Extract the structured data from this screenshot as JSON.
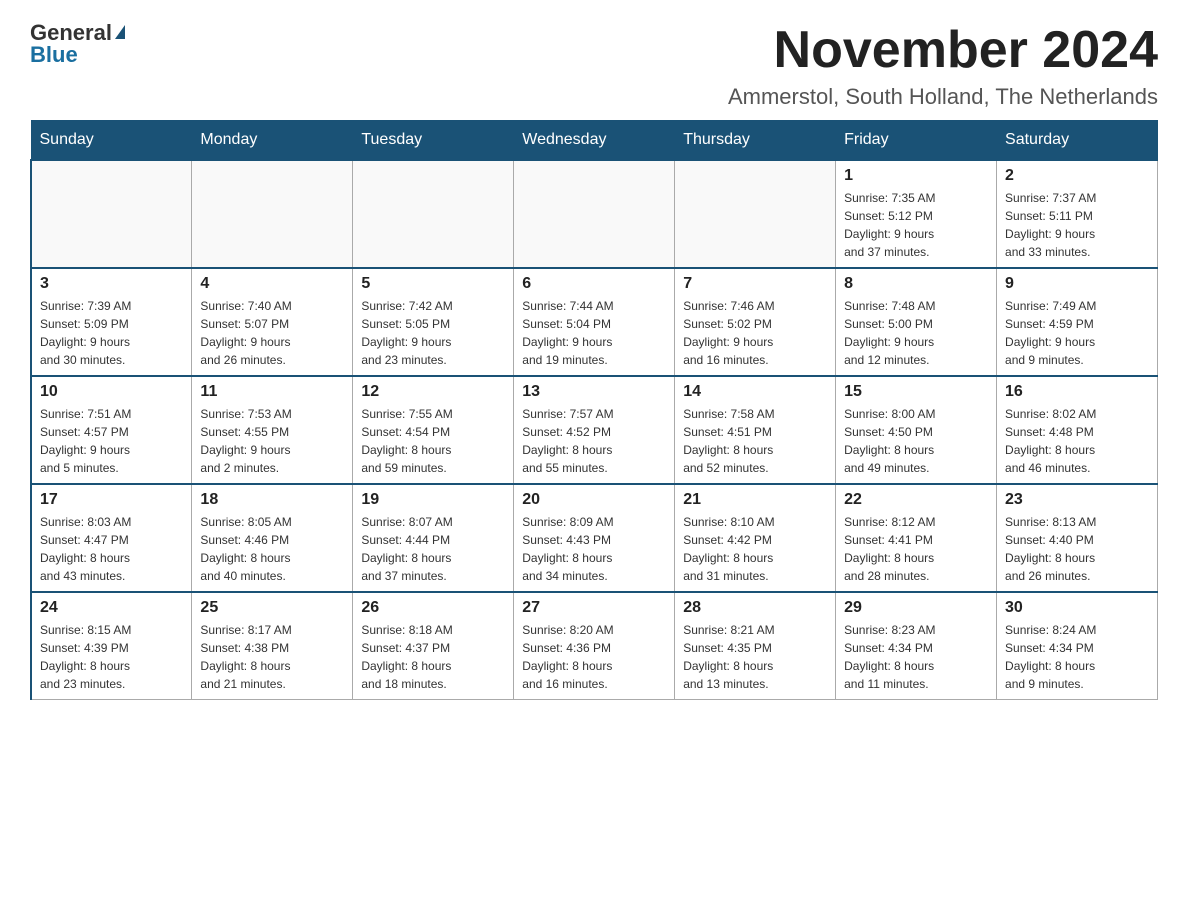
{
  "logo": {
    "general": "General",
    "blue": "Blue"
  },
  "header": {
    "month_title": "November 2024",
    "location": "Ammerstol, South Holland, The Netherlands"
  },
  "weekdays": [
    "Sunday",
    "Monday",
    "Tuesday",
    "Wednesday",
    "Thursday",
    "Friday",
    "Saturday"
  ],
  "weeks": [
    [
      {
        "day": "",
        "info": ""
      },
      {
        "day": "",
        "info": ""
      },
      {
        "day": "",
        "info": ""
      },
      {
        "day": "",
        "info": ""
      },
      {
        "day": "",
        "info": ""
      },
      {
        "day": "1",
        "info": "Sunrise: 7:35 AM\nSunset: 5:12 PM\nDaylight: 9 hours\nand 37 minutes."
      },
      {
        "day": "2",
        "info": "Sunrise: 7:37 AM\nSunset: 5:11 PM\nDaylight: 9 hours\nand 33 minutes."
      }
    ],
    [
      {
        "day": "3",
        "info": "Sunrise: 7:39 AM\nSunset: 5:09 PM\nDaylight: 9 hours\nand 30 minutes."
      },
      {
        "day": "4",
        "info": "Sunrise: 7:40 AM\nSunset: 5:07 PM\nDaylight: 9 hours\nand 26 minutes."
      },
      {
        "day": "5",
        "info": "Sunrise: 7:42 AM\nSunset: 5:05 PM\nDaylight: 9 hours\nand 23 minutes."
      },
      {
        "day": "6",
        "info": "Sunrise: 7:44 AM\nSunset: 5:04 PM\nDaylight: 9 hours\nand 19 minutes."
      },
      {
        "day": "7",
        "info": "Sunrise: 7:46 AM\nSunset: 5:02 PM\nDaylight: 9 hours\nand 16 minutes."
      },
      {
        "day": "8",
        "info": "Sunrise: 7:48 AM\nSunset: 5:00 PM\nDaylight: 9 hours\nand 12 minutes."
      },
      {
        "day": "9",
        "info": "Sunrise: 7:49 AM\nSunset: 4:59 PM\nDaylight: 9 hours\nand 9 minutes."
      }
    ],
    [
      {
        "day": "10",
        "info": "Sunrise: 7:51 AM\nSunset: 4:57 PM\nDaylight: 9 hours\nand 5 minutes."
      },
      {
        "day": "11",
        "info": "Sunrise: 7:53 AM\nSunset: 4:55 PM\nDaylight: 9 hours\nand 2 minutes."
      },
      {
        "day": "12",
        "info": "Sunrise: 7:55 AM\nSunset: 4:54 PM\nDaylight: 8 hours\nand 59 minutes."
      },
      {
        "day": "13",
        "info": "Sunrise: 7:57 AM\nSunset: 4:52 PM\nDaylight: 8 hours\nand 55 minutes."
      },
      {
        "day": "14",
        "info": "Sunrise: 7:58 AM\nSunset: 4:51 PM\nDaylight: 8 hours\nand 52 minutes."
      },
      {
        "day": "15",
        "info": "Sunrise: 8:00 AM\nSunset: 4:50 PM\nDaylight: 8 hours\nand 49 minutes."
      },
      {
        "day": "16",
        "info": "Sunrise: 8:02 AM\nSunset: 4:48 PM\nDaylight: 8 hours\nand 46 minutes."
      }
    ],
    [
      {
        "day": "17",
        "info": "Sunrise: 8:03 AM\nSunset: 4:47 PM\nDaylight: 8 hours\nand 43 minutes."
      },
      {
        "day": "18",
        "info": "Sunrise: 8:05 AM\nSunset: 4:46 PM\nDaylight: 8 hours\nand 40 minutes."
      },
      {
        "day": "19",
        "info": "Sunrise: 8:07 AM\nSunset: 4:44 PM\nDaylight: 8 hours\nand 37 minutes."
      },
      {
        "day": "20",
        "info": "Sunrise: 8:09 AM\nSunset: 4:43 PM\nDaylight: 8 hours\nand 34 minutes."
      },
      {
        "day": "21",
        "info": "Sunrise: 8:10 AM\nSunset: 4:42 PM\nDaylight: 8 hours\nand 31 minutes."
      },
      {
        "day": "22",
        "info": "Sunrise: 8:12 AM\nSunset: 4:41 PM\nDaylight: 8 hours\nand 28 minutes."
      },
      {
        "day": "23",
        "info": "Sunrise: 8:13 AM\nSunset: 4:40 PM\nDaylight: 8 hours\nand 26 minutes."
      }
    ],
    [
      {
        "day": "24",
        "info": "Sunrise: 8:15 AM\nSunset: 4:39 PM\nDaylight: 8 hours\nand 23 minutes."
      },
      {
        "day": "25",
        "info": "Sunrise: 8:17 AM\nSunset: 4:38 PM\nDaylight: 8 hours\nand 21 minutes."
      },
      {
        "day": "26",
        "info": "Sunrise: 8:18 AM\nSunset: 4:37 PM\nDaylight: 8 hours\nand 18 minutes."
      },
      {
        "day": "27",
        "info": "Sunrise: 8:20 AM\nSunset: 4:36 PM\nDaylight: 8 hours\nand 16 minutes."
      },
      {
        "day": "28",
        "info": "Sunrise: 8:21 AM\nSunset: 4:35 PM\nDaylight: 8 hours\nand 13 minutes."
      },
      {
        "day": "29",
        "info": "Sunrise: 8:23 AM\nSunset: 4:34 PM\nDaylight: 8 hours\nand 11 minutes."
      },
      {
        "day": "30",
        "info": "Sunrise: 8:24 AM\nSunset: 4:34 PM\nDaylight: 8 hours\nand 9 minutes."
      }
    ]
  ]
}
